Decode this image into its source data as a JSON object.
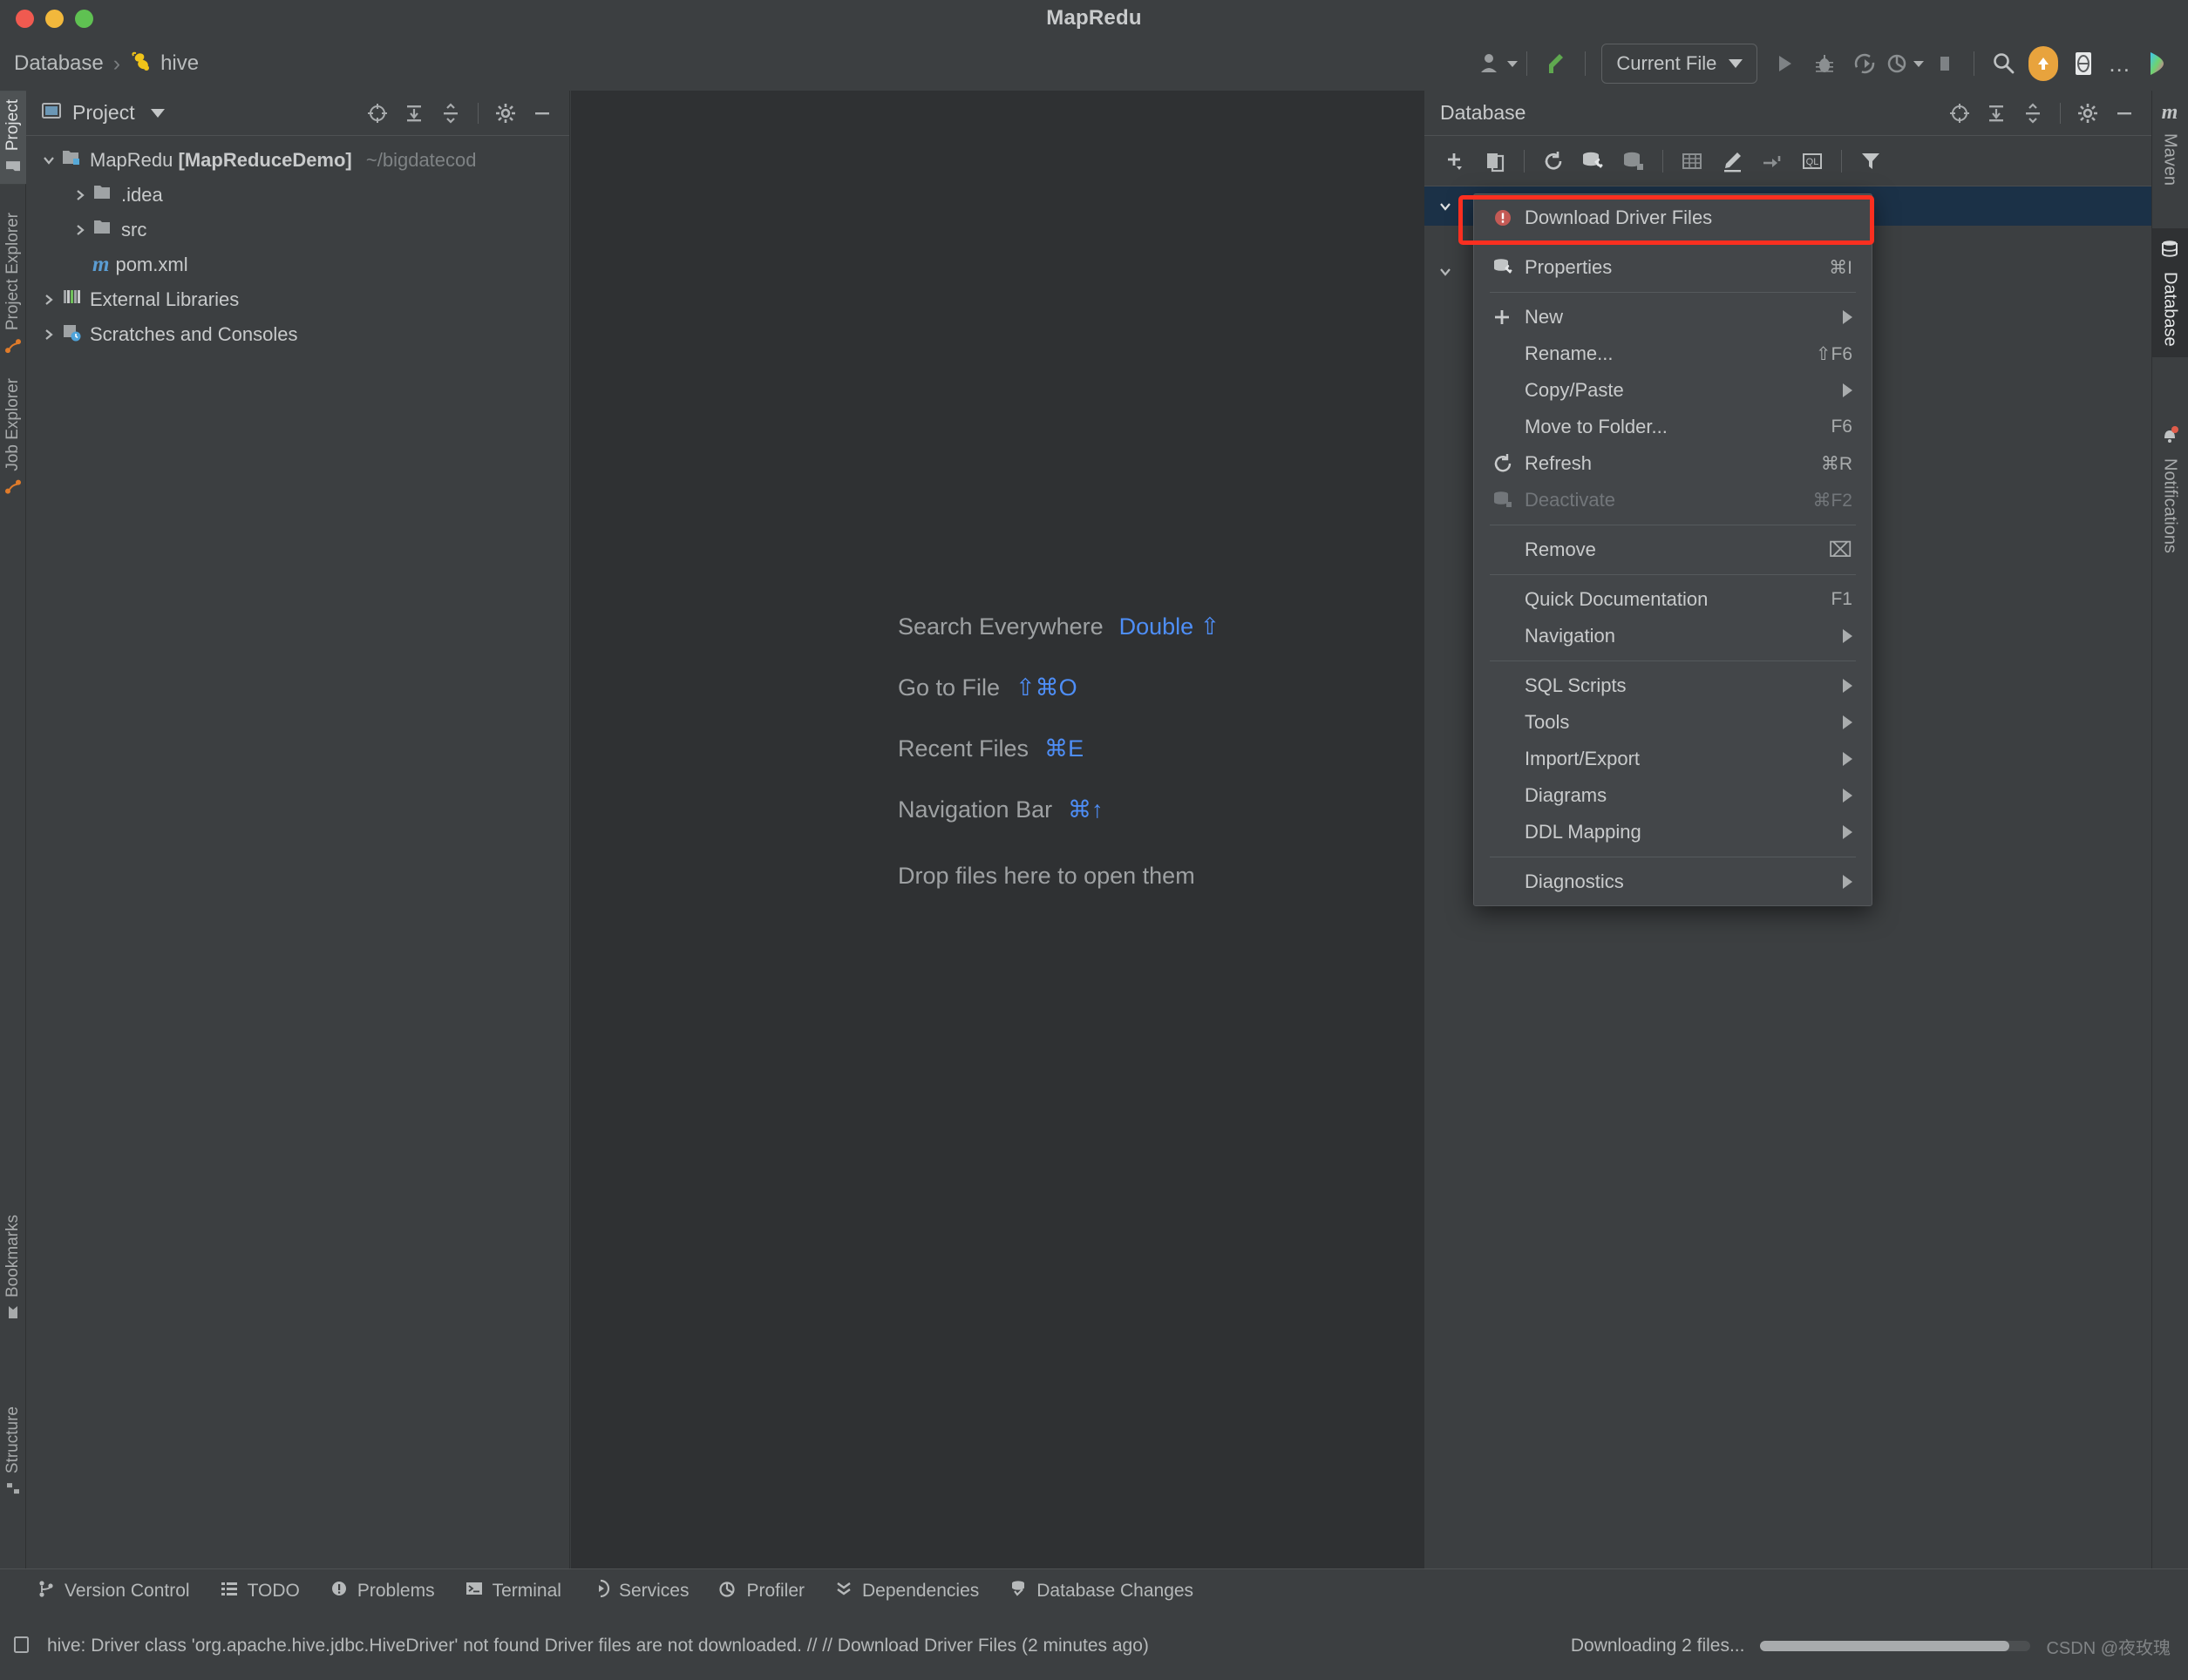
{
  "window": {
    "title": "MapRedu",
    "traffic_lights": [
      "close",
      "minimize",
      "maximize"
    ]
  },
  "breadcrumb": {
    "root": "Database",
    "separator": "›",
    "current": "hive",
    "current_icon": "hive-bee-icon"
  },
  "main_toolbar": {
    "run_config": "Current File",
    "buttons": [
      {
        "name": "user-account-icon",
        "label": "Account"
      },
      {
        "name": "vcs-update-icon",
        "label": "Update Project"
      },
      {
        "name": "run-icon",
        "label": "Run"
      },
      {
        "name": "debug-icon",
        "label": "Debug"
      },
      {
        "name": "run-with-coverage-icon",
        "label": "Run with Coverage"
      },
      {
        "name": "profiler-icon",
        "label": "Profiler"
      },
      {
        "name": "stop-icon",
        "label": "Stop"
      },
      {
        "name": "search-icon",
        "label": "Search Everywhere"
      },
      {
        "name": "update-available-icon",
        "label": "IDE and Plugin Updates"
      },
      {
        "name": "code-with-me-icon",
        "label": "Code With Me"
      },
      {
        "name": "more-options-icon",
        "label": "..."
      },
      {
        "name": "ai-assistant-icon",
        "label": "AI Assistant"
      }
    ],
    "more_dots": "..."
  },
  "left_strip": {
    "tabs": [
      {
        "label": "Project",
        "icon": "project-folder-icon",
        "active": true
      },
      {
        "label": "Project Explorer",
        "icon": "bigdata-explorer-icon",
        "active": false
      },
      {
        "label": "Job Explorer",
        "icon": "bigdata-job-icon",
        "active": false
      }
    ],
    "bottom_tabs": [
      {
        "label": "Bookmarks",
        "icon": "bookmark-icon",
        "active": false
      },
      {
        "label": "Structure",
        "icon": "structure-icon",
        "active": false
      }
    ]
  },
  "project_panel": {
    "title": "Project",
    "header_icons": [
      {
        "name": "select-opened-file-icon"
      },
      {
        "name": "expand-all-icon"
      },
      {
        "name": "collapse-all-icon"
      },
      {
        "name": "gear-icon"
      },
      {
        "name": "minimize-icon"
      }
    ],
    "tree": [
      {
        "depth": 0,
        "twisty": "expanded",
        "icon": "module-folder-icon",
        "label": "MapRedu",
        "bold_suffix": "[MapReduceDemo]",
        "path": "~/bigdatecod"
      },
      {
        "depth": 1,
        "twisty": "collapsed",
        "icon": "folder-icon",
        "label": ".idea",
        "bold_suffix": "",
        "path": ""
      },
      {
        "depth": 1,
        "twisty": "collapsed",
        "icon": "folder-icon",
        "label": "src",
        "bold_suffix": "",
        "path": ""
      },
      {
        "depth": 1,
        "twisty": "none",
        "icon": "maven-m-icon",
        "label": "pom.xml",
        "bold_suffix": "",
        "path": ""
      },
      {
        "depth": 0,
        "twisty": "collapsed",
        "icon": "libraries-icon",
        "label": "External Libraries",
        "bold_suffix": "",
        "path": ""
      },
      {
        "depth": 0,
        "twisty": "collapsed",
        "icon": "scratches-icon",
        "label": "Scratches and Consoles",
        "bold_suffix": "",
        "path": ""
      }
    ]
  },
  "editor": {
    "shortcuts": [
      {
        "action": "Search Everywhere",
        "key": "Double ⇧"
      },
      {
        "action": "Go to File",
        "key": "⇧⌘O"
      },
      {
        "action": "Recent Files",
        "key": "⌘E"
      },
      {
        "action": "Navigation Bar",
        "key": "⌘↑"
      }
    ],
    "drop_hint": "Drop files here to open them"
  },
  "database_panel": {
    "title": "Database",
    "header_icons": [
      {
        "name": "select-opened-file-icon"
      },
      {
        "name": "expand-all-icon"
      },
      {
        "name": "collapse-all-icon"
      },
      {
        "name": "gear-icon"
      },
      {
        "name": "minimize-icon"
      }
    ],
    "toolbar_icons": [
      {
        "name": "add-data-source-icon",
        "label": "New"
      },
      {
        "name": "duplicate-icon",
        "label": "Duplicate"
      },
      {
        "name": "refresh-icon",
        "label": "Refresh"
      },
      {
        "name": "data-source-properties-icon",
        "label": "Properties"
      },
      {
        "name": "deactivate-datasource-icon",
        "label": "Deactivate"
      },
      {
        "name": "table-editor-icon",
        "label": "Table Editor"
      },
      {
        "name": "modify-icon",
        "label": "Modify"
      },
      {
        "name": "jump-to-console-icon",
        "label": "Jump to Console"
      },
      {
        "name": "query-console-icon",
        "label": "Open Query Console"
      },
      {
        "name": "filter-icon",
        "label": "Filter"
      }
    ],
    "rows": [
      {
        "twisty": "expanded",
        "selected": true
      },
      {
        "twisty": "expanded",
        "selected": false
      }
    ]
  },
  "right_strip": {
    "tabs": [
      {
        "label": "Maven",
        "icon": "maven-m-icon",
        "active": false
      },
      {
        "label": "Database",
        "icon": "database-icon",
        "active": true
      },
      {
        "label": "Notifications",
        "icon": "notifications-bell-icon",
        "active": false,
        "badge": true
      }
    ]
  },
  "context_menu": {
    "highlighted_item": "Download Driver Files",
    "items": [
      {
        "type": "item",
        "label": "Download Driver Files",
        "shortcut": "",
        "icon": "error-circle-icon",
        "submenu": false,
        "disabled": false,
        "highlighted": true
      },
      {
        "type": "separator"
      },
      {
        "type": "item",
        "label": "Properties",
        "shortcut": "⌘I",
        "icon": "data-source-properties-icon",
        "submenu": false,
        "disabled": false
      },
      {
        "type": "separator"
      },
      {
        "type": "item",
        "label": "New",
        "shortcut": "",
        "icon": "plus-icon",
        "submenu": true,
        "disabled": false
      },
      {
        "type": "item",
        "label": "Rename...",
        "shortcut": "⇧F6",
        "icon": "",
        "submenu": false,
        "disabled": false
      },
      {
        "type": "item",
        "label": "Copy/Paste",
        "shortcut": "",
        "icon": "",
        "submenu": true,
        "disabled": false
      },
      {
        "type": "item",
        "label": "Move to Folder...",
        "shortcut": "F6",
        "icon": "",
        "submenu": false,
        "disabled": false
      },
      {
        "type": "item",
        "label": "Refresh",
        "shortcut": "⌘R",
        "icon": "refresh-icon",
        "submenu": false,
        "disabled": false
      },
      {
        "type": "item",
        "label": "Deactivate",
        "shortcut": "⌘F2",
        "icon": "deactivate-datasource-icon",
        "submenu": false,
        "disabled": true
      },
      {
        "type": "separator"
      },
      {
        "type": "item",
        "label": "Remove",
        "shortcut": "⌧",
        "icon": "",
        "submenu": false,
        "disabled": false
      },
      {
        "type": "separator"
      },
      {
        "type": "item",
        "label": "Quick Documentation",
        "shortcut": "F1",
        "icon": "",
        "submenu": false,
        "disabled": false
      },
      {
        "type": "item",
        "label": "Navigation",
        "shortcut": "",
        "icon": "",
        "submenu": true,
        "disabled": false
      },
      {
        "type": "separator"
      },
      {
        "type": "item",
        "label": "SQL Scripts",
        "shortcut": "",
        "icon": "",
        "submenu": true,
        "disabled": false
      },
      {
        "type": "item",
        "label": "Tools",
        "shortcut": "",
        "icon": "",
        "submenu": true,
        "disabled": false
      },
      {
        "type": "item",
        "label": "Import/Export",
        "shortcut": "",
        "icon": "",
        "submenu": true,
        "disabled": false
      },
      {
        "type": "item",
        "label": "Diagrams",
        "shortcut": "",
        "icon": "",
        "submenu": true,
        "disabled": false
      },
      {
        "type": "item",
        "label": "DDL Mapping",
        "shortcut": "",
        "icon": "",
        "submenu": true,
        "disabled": false
      },
      {
        "type": "separator"
      },
      {
        "type": "item",
        "label": "Diagnostics",
        "shortcut": "",
        "icon": "",
        "submenu": true,
        "disabled": false
      }
    ]
  },
  "bottom_bar": {
    "items": [
      {
        "label": "Version Control",
        "icon": "vcs-branch-icon"
      },
      {
        "label": "TODO",
        "icon": "todo-list-icon"
      },
      {
        "label": "Problems",
        "icon": "problems-warning-icon"
      },
      {
        "label": "Terminal",
        "icon": "terminal-icon"
      },
      {
        "label": "Services",
        "icon": "services-icon"
      },
      {
        "label": "Profiler",
        "icon": "profiler-icon"
      },
      {
        "label": "Dependencies",
        "icon": "dependencies-icon"
      },
      {
        "label": "Database Changes",
        "icon": "database-changes-icon"
      }
    ]
  },
  "status_bar": {
    "message": "hive: Driver class 'org.apache.hive.jdbc.HiveDriver' not found Driver files are not downloaded. // // Download Driver Files (2 minutes ago)",
    "message_icon": "notification-square-icon",
    "progress_label": "Downloading 2 files...",
    "progress_percent": 92,
    "watermark": "CSDN @夜玫瑰"
  },
  "colors": {
    "panel_bg": "#3c3f41",
    "editor_bg": "#2f3133",
    "menu_bg": "#434649",
    "selection": "#1b3147",
    "accent_blue": "#4e8ef7",
    "highlight_red": "#fa2f20",
    "update_orange": "#e8a33d",
    "hive_yellow": "#f0c419"
  }
}
